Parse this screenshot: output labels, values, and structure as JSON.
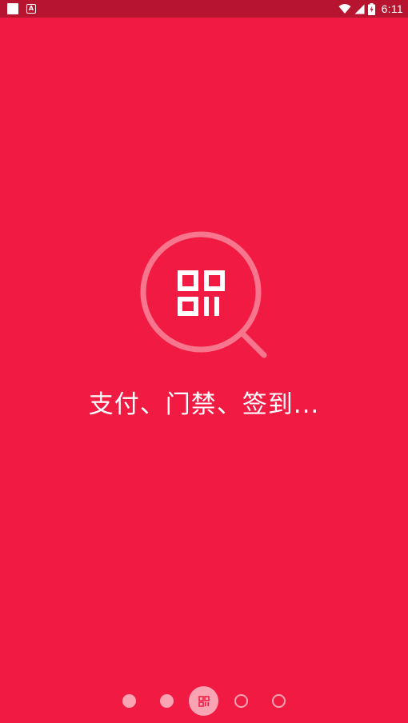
{
  "status_bar": {
    "time": "6:11",
    "left_icons": [
      "app-notification-icon",
      "a-notification-icon"
    ],
    "right_icons": [
      "wifi-icon",
      "signal-icon",
      "battery-charging-icon"
    ]
  },
  "onboarding": {
    "hero_icon": "qr-scan-magnifier-icon",
    "caption": "支付、门禁、签到..."
  },
  "pager": {
    "pages": 5,
    "active_index": 2,
    "active_icon": "qr-code-icon"
  },
  "colors": {
    "background": "#f01a42",
    "status_bar": "#b6142f",
    "pager_dot": "#f9a3b3",
    "text": "#ffffff"
  }
}
